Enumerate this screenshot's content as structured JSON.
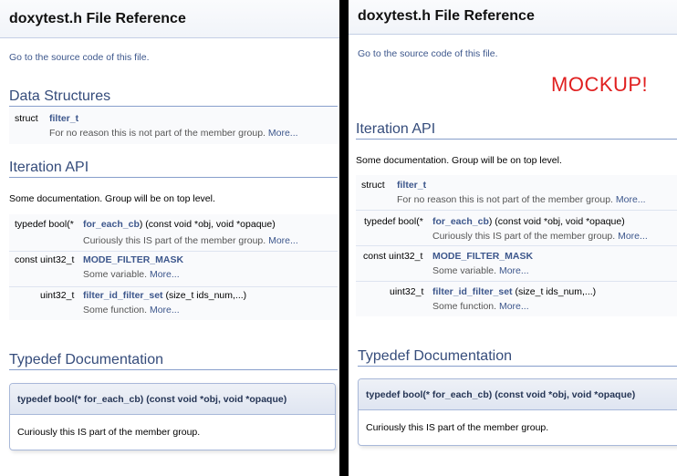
{
  "page_title": "doxytest.h File Reference",
  "source_link": "Go to the source code of this file.",
  "mockup_label": "MOCKUP!",
  "headings": {
    "data_structures": "Data Structures",
    "iteration_api": "Iteration API",
    "typedef_documentation": "Typedef Documentation"
  },
  "group_doc": "Some documentation. Group will be on top level.",
  "more": "More...",
  "members": {
    "filter_t": {
      "type": "struct",
      "name": "filter_t",
      "brief": "For no reason this is not part of the member group."
    },
    "for_each_cb": {
      "type": "typedef bool(*",
      "name": "for_each_cb",
      "args": ") (const void *obj, void *opaque)",
      "brief": "Curiously this IS part of the member group."
    },
    "mode_filter_mask": {
      "type": "const uint32_t",
      "name": "MODE_FILTER_MASK",
      "brief": "Some variable."
    },
    "filter_id_filter_set": {
      "type": "uint32_t",
      "name": "filter_id_filter_set",
      "args": " (size_t ids_num,...)",
      "brief": "Some function."
    }
  },
  "typedef_doc": {
    "title": "typedef bool(* for_each_cb) (const void *obj, void *opaque)",
    "body": "Curiously this IS part of the member group."
  },
  "colors": {
    "divider": "#000000",
    "link": "#3d578c",
    "heading": "#354c7b",
    "mockup": "#e02020"
  }
}
